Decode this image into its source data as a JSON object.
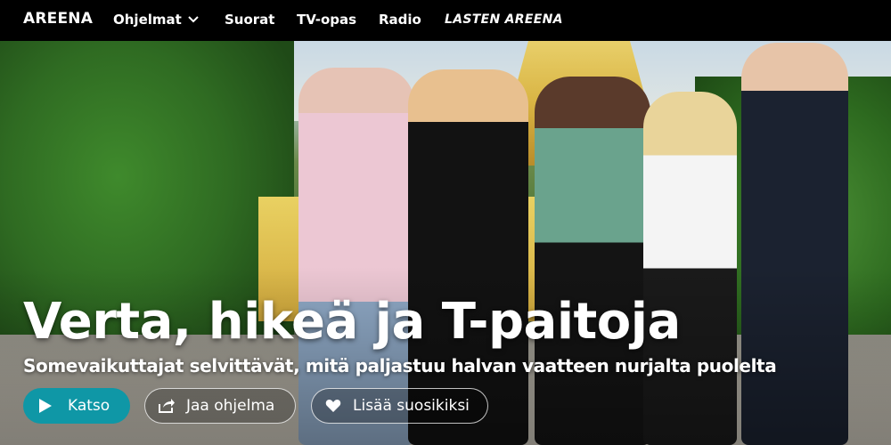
{
  "nav": {
    "logo": "AREENA",
    "items": [
      {
        "label": "Ohjelmat",
        "has_dropdown": true
      },
      {
        "label": "Suorat"
      },
      {
        "label": "TV-opas"
      },
      {
        "label": "Radio"
      },
      {
        "label": "LASTEN AREENA"
      }
    ]
  },
  "hero": {
    "title": "Verta, hikeä ja T-paitoja",
    "subtitle": "Somevaikuttajat selvittävät, mitä paljastuu halvan vaatteen nurjalta puolelta",
    "actions": {
      "watch": {
        "label": "Katso",
        "icon": "play-icon",
        "color": "#0f97a6"
      },
      "share": {
        "label": "Jaa ohjelma",
        "icon": "share-icon"
      },
      "favorite": {
        "label": "Lisää suosikiksi",
        "icon": "heart-icon"
      }
    }
  }
}
